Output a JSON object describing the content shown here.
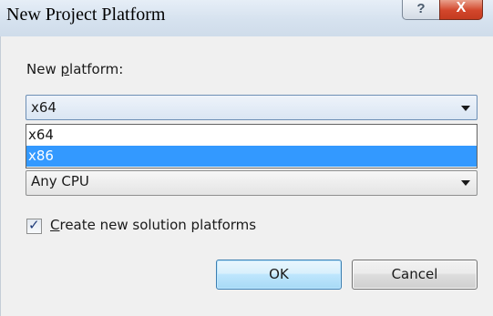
{
  "window": {
    "title": "New Project Platform",
    "help_glyph": "?",
    "close_glyph": "X"
  },
  "form": {
    "platform_label_prefix": "New ",
    "platform_label_accesskey": "p",
    "platform_label_suffix": "latform:",
    "platform_combo": {
      "selected": "x64",
      "options": [
        "x64",
        "x86"
      ],
      "highlighted_option": "x86"
    },
    "copy_from_combo": {
      "selected": "Any CPU"
    },
    "create_solution_platforms": {
      "checked": true,
      "label_accesskey": "C",
      "label_rest": "reate new solution platforms"
    }
  },
  "buttons": {
    "ok_label": "OK",
    "cancel_label": "Cancel"
  },
  "colors": {
    "selection": "#3399ff",
    "close_button": "#d2462b",
    "ok_border": "#3c7fb1"
  }
}
